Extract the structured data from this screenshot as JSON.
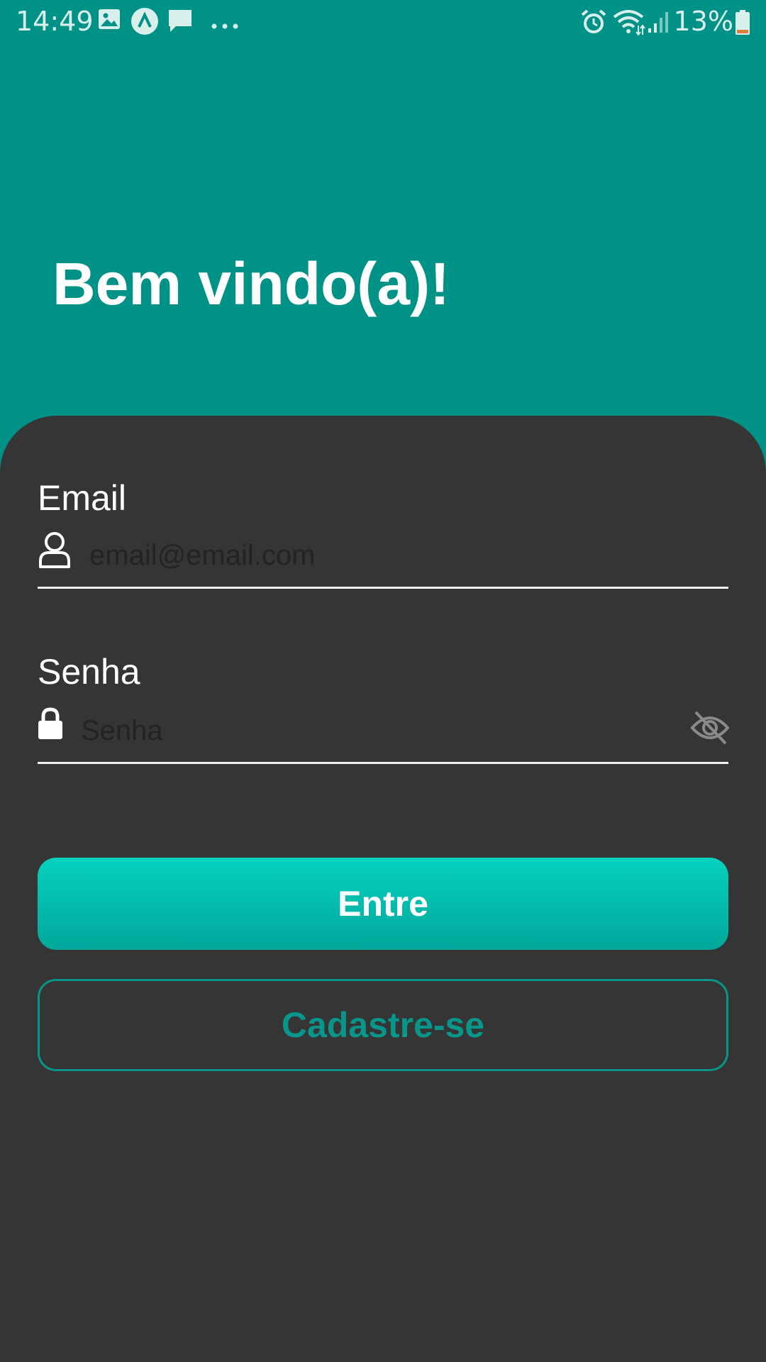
{
  "status_bar": {
    "time": "14:49",
    "battery_percent": "13%",
    "icons_left": [
      "gallery-icon",
      "app-a-icon",
      "message-icon",
      "more-dots-icon"
    ],
    "icons_right": [
      "alarm-icon",
      "wifi-icon",
      "signal-icon",
      "battery-icon"
    ]
  },
  "header": {
    "title": "Bem vindo(a)!"
  },
  "form": {
    "email_label": "Email",
    "email_placeholder": "email@email.com",
    "email_value": "",
    "password_label": "Senha",
    "password_placeholder": "Senha",
    "password_value": ""
  },
  "buttons": {
    "login_label": "Entre",
    "signup_label": "Cadastre-se"
  },
  "colors": {
    "background_top": "#009286",
    "card": "#353535",
    "accent": "#07d1bf",
    "accent_outline": "#08958a"
  }
}
